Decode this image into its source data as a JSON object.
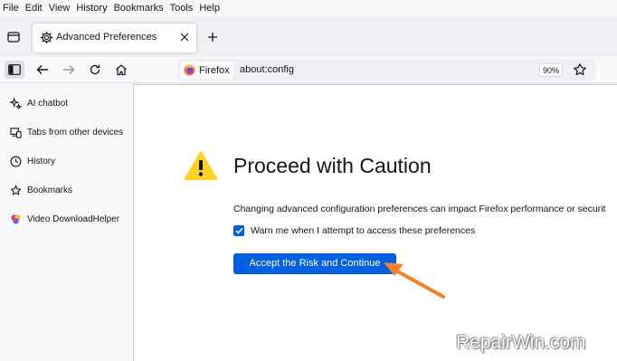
{
  "menubar": {
    "items": [
      "File",
      "Edit",
      "View",
      "History",
      "Bookmarks",
      "Tools",
      "Help"
    ]
  },
  "tab": {
    "title": "Advanced Preferences",
    "icon": "gear-icon"
  },
  "urlbar": {
    "identity_label": "Firefox",
    "url": "about:config",
    "zoom": "90%"
  },
  "sidebar": {
    "items": [
      {
        "label": "AI chatbot",
        "icon": "ai-sparkle-icon"
      },
      {
        "label": "Tabs from other devices",
        "icon": "synced-tabs-icon"
      },
      {
        "label": "History",
        "icon": "history-clock-icon"
      },
      {
        "label": "Bookmarks",
        "icon": "bookmark-star-icon"
      },
      {
        "label": "Video DownloadHelper",
        "icon": "extension-icon"
      }
    ]
  },
  "page": {
    "heading": "Proceed with Caution",
    "description": "Changing advanced configuration preferences can impact Firefox performance or securit",
    "checkbox_label": "Warn me when I attempt to access these preferences",
    "checkbox_checked": true,
    "accept_button": "Accept the Risk and Continue"
  },
  "watermark": "RepairWin.com",
  "colors": {
    "accent": "#0061e0",
    "warning": "#ffd321",
    "arrow": "#f2832a"
  }
}
